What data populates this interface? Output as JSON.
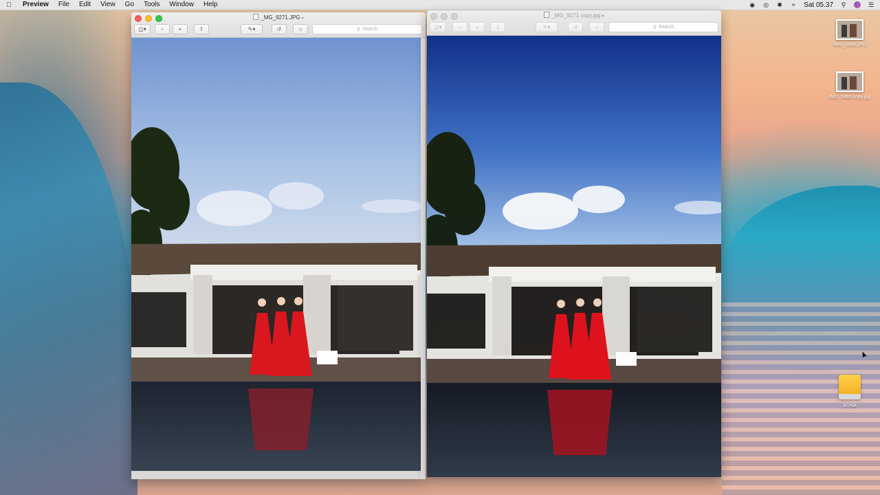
{
  "menubar": {
    "apple_icon": "apple-logo-icon",
    "app_name": "Preview",
    "items": [
      "File",
      "Edit",
      "View",
      "Go",
      "Tools",
      "Window",
      "Help"
    ],
    "clock": "Sat 05.37"
  },
  "windows": {
    "left": {
      "title": "_MG_9271.JPG",
      "search_placeholder": "Search",
      "active": true
    },
    "right": {
      "title": "_MG_9271 copy.jpg",
      "search_placeholder": "Search",
      "active": false
    }
  },
  "desktop": {
    "icons": [
      {
        "label": "IMG_0489.JPG"
      },
      {
        "label": "IMG_0489 copy.jpg"
      },
      {
        "label": "BONA"
      }
    ]
  },
  "colors": {
    "traffic_close": "#fc5f57",
    "traffic_min": "#fdbc2e",
    "traffic_max": "#33c748",
    "dress_red": "#d8171f"
  }
}
